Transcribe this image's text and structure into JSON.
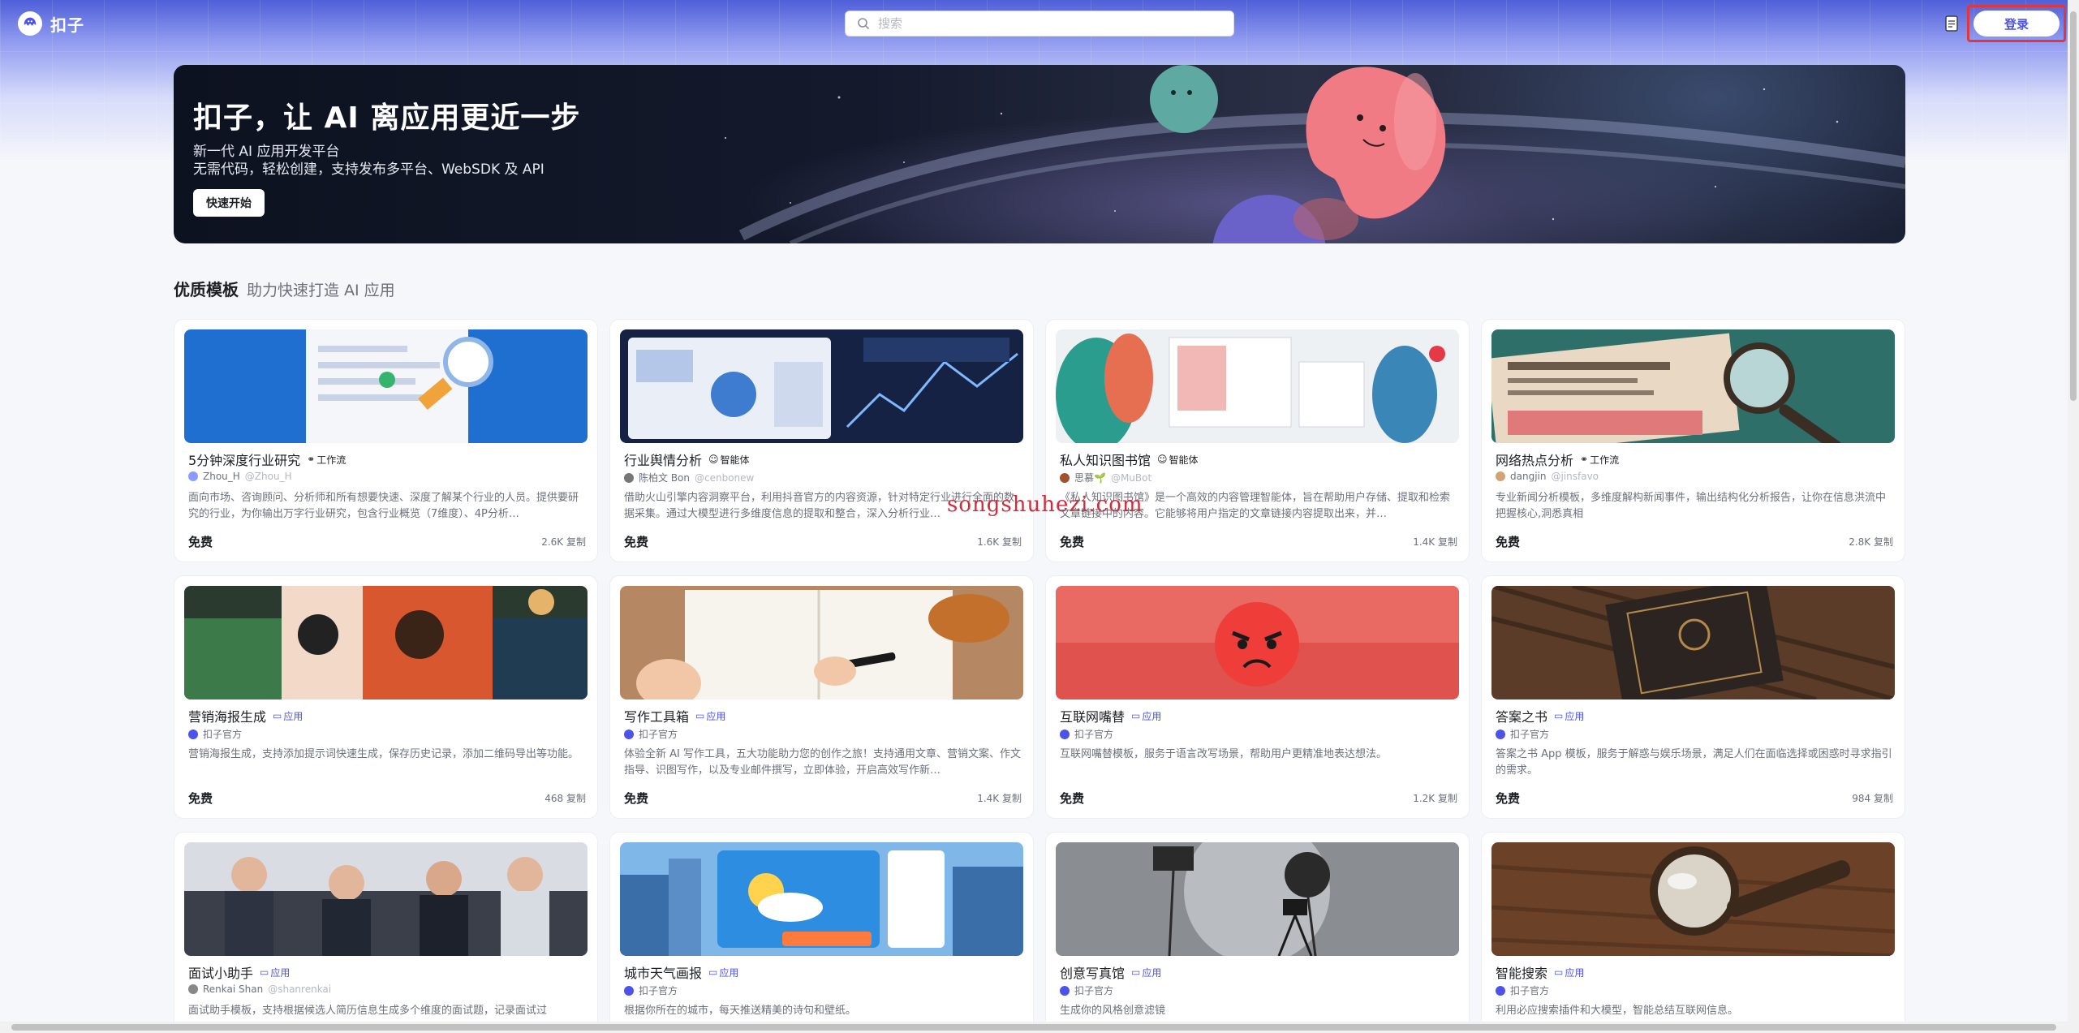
{
  "app": {
    "name": "扣子"
  },
  "search": {
    "placeholder": "搜索"
  },
  "header": {
    "login_label": "登录"
  },
  "banner": {
    "title": "扣子，让 AI 离应用更近一步",
    "subtitle1": "新一代 AI 应用开发平台",
    "subtitle2": "无需代码，轻松创建，支持发布多平台、WebSDK 及 API",
    "button_label": "快速开始"
  },
  "section": {
    "title": "优质模板",
    "subtitle": "助力快速打造 AI 应用"
  },
  "watermark": "songshuhezi.com",
  "cards": [
    {
      "title": "5分钟深度行业研究",
      "tag": "工作流",
      "tag_type": "workflow",
      "author": "Zhou_H",
      "handle": "@Zhou_H",
      "desc": "面向市场、咨询顾问、分析师和所有想要快速、深度了解某个行业的人员。提供要研究的行业，为你输出万字行业研究，包含行业概览（7维度）、4P分析…",
      "price": "免费",
      "stat": "2.6K 复制"
    },
    {
      "title": "行业舆情分析",
      "tag": "智能体",
      "tag_type": "agent",
      "author": "陈柏文 Bon",
      "handle": "@cenbonew",
      "desc": "借助火山引擎内容洞察平台，利用抖音官方的内容资源，针对特定行业进行全面的数据采集。通过大模型进行多维度信息的提取和整合，深入分析行业…",
      "price": "免费",
      "stat": "1.6K 复制"
    },
    {
      "title": "私人知识图书馆",
      "tag": "智能体",
      "tag_type": "agent",
      "author": "思慕🌱",
      "handle": "@MuBot",
      "desc": "《私人知识图书馆》是一个高效的内容管理智能体，旨在帮助用户存储、提取和检索文章链接中的内容。它能够将用户指定的文章链接内容提取出来，并…",
      "price": "免费",
      "stat": "1.4K 复制"
    },
    {
      "title": "网络热点分析",
      "tag": "工作流",
      "tag_type": "workflow",
      "author": "dangjin",
      "handle": "@jinsfavo",
      "desc": "专业新闻分析模板，多维度解构新闻事件，输出结构化分析报告，让你在信息洪流中把握核心,洞悉真相",
      "price": "免费",
      "stat": "2.8K 复制"
    },
    {
      "title": "营销海报生成",
      "tag": "应用",
      "tag_type": "app",
      "author": "扣子官方",
      "handle": "",
      "desc": "营销海报生成，支持添加提示词快速生成，保存历史记录，添加二维码导出等功能。",
      "price": "免费",
      "stat": "468 复制"
    },
    {
      "title": "写作工具箱",
      "tag": "应用",
      "tag_type": "app",
      "author": "扣子官方",
      "handle": "",
      "desc": "体验全新 AI 写作工具，五大功能助力您的创作之旅！支持通用文章、营销文案、作文指导、识图写作，以及专业邮件撰写，立即体验，开启高效写作新…",
      "price": "免费",
      "stat": "1.4K 复制"
    },
    {
      "title": "互联网嘴替",
      "tag": "应用",
      "tag_type": "app",
      "author": "扣子官方",
      "handle": "",
      "desc": "互联网嘴替模板，服务于语言改写场景，帮助用户更精准地表达想法。",
      "price": "免费",
      "stat": "1.2K 复制"
    },
    {
      "title": "答案之书",
      "tag": "应用",
      "tag_type": "app",
      "author": "扣子官方",
      "handle": "",
      "desc": "答案之书 App 模板，服务于解惑与娱乐场景，满足人们在面临选择或困惑时寻求指引的需求。",
      "price": "免费",
      "stat": "984 复制"
    },
    {
      "title": "面试小助手",
      "tag": "应用",
      "tag_type": "app",
      "author": "Renkai Shan",
      "handle": "@shanrenkai",
      "desc": "面试助手模板，支持根据候选人简历信息生成多个维度的面试题，记录面试过",
      "price": "",
      "stat": ""
    },
    {
      "title": "城市天气画报",
      "tag": "应用",
      "tag_type": "app",
      "author": "扣子官方",
      "handle": "",
      "desc": "根据你所在的城市，每天推送精美的诗句和壁纸。",
      "price": "",
      "stat": ""
    },
    {
      "title": "创意写真馆",
      "tag": "应用",
      "tag_type": "app",
      "author": "扣子官方",
      "handle": "",
      "desc": "生成你的风格创意滤镜",
      "price": "",
      "stat": ""
    },
    {
      "title": "智能搜索",
      "tag": "应用",
      "tag_type": "app",
      "author": "扣子官方",
      "handle": "",
      "desc": "利用必应搜索插件和大模型，智能总结互联网信息。",
      "price": "",
      "stat": ""
    }
  ],
  "icons": {
    "logo": "coze-logo-icon",
    "search": "search-icon",
    "docs": "document-icon",
    "workflow": "workflow-icon",
    "agent": "agent-icon",
    "app": "app-icon"
  },
  "colors": {
    "accent": "#4d53e8",
    "login_outline": "#e0373c",
    "watermark": "#d42a3a"
  }
}
